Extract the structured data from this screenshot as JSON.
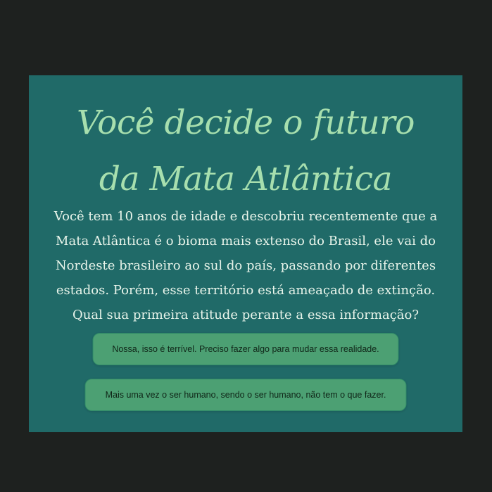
{
  "page": {
    "title": "Você decide o futuro da Mata Atlântica",
    "story": "Você tem 10 anos de idade e descobriu recentemente que a Mata Atlântica é o bioma mais extenso do Brasil, ele vai do Nordeste brasileiro ao sul do país, passando por diferentes estados. Porém, esse território está ameaçado de extinção. Qual sua primeira atitude perante a essa informação?"
  },
  "choices": [
    {
      "label": "Nossa, isso é terrível. Preciso fazer algo para mudar essa realidade."
    },
    {
      "label": "Mais uma vez o ser humano, sendo o ser humano, não tem o que fazer."
    }
  ],
  "colors": {
    "background": "#1e211f",
    "card": "#206a68",
    "title": "#a7dfae",
    "text": "#e8f4ea",
    "button": "#4ca073",
    "button_text": "#102618"
  }
}
